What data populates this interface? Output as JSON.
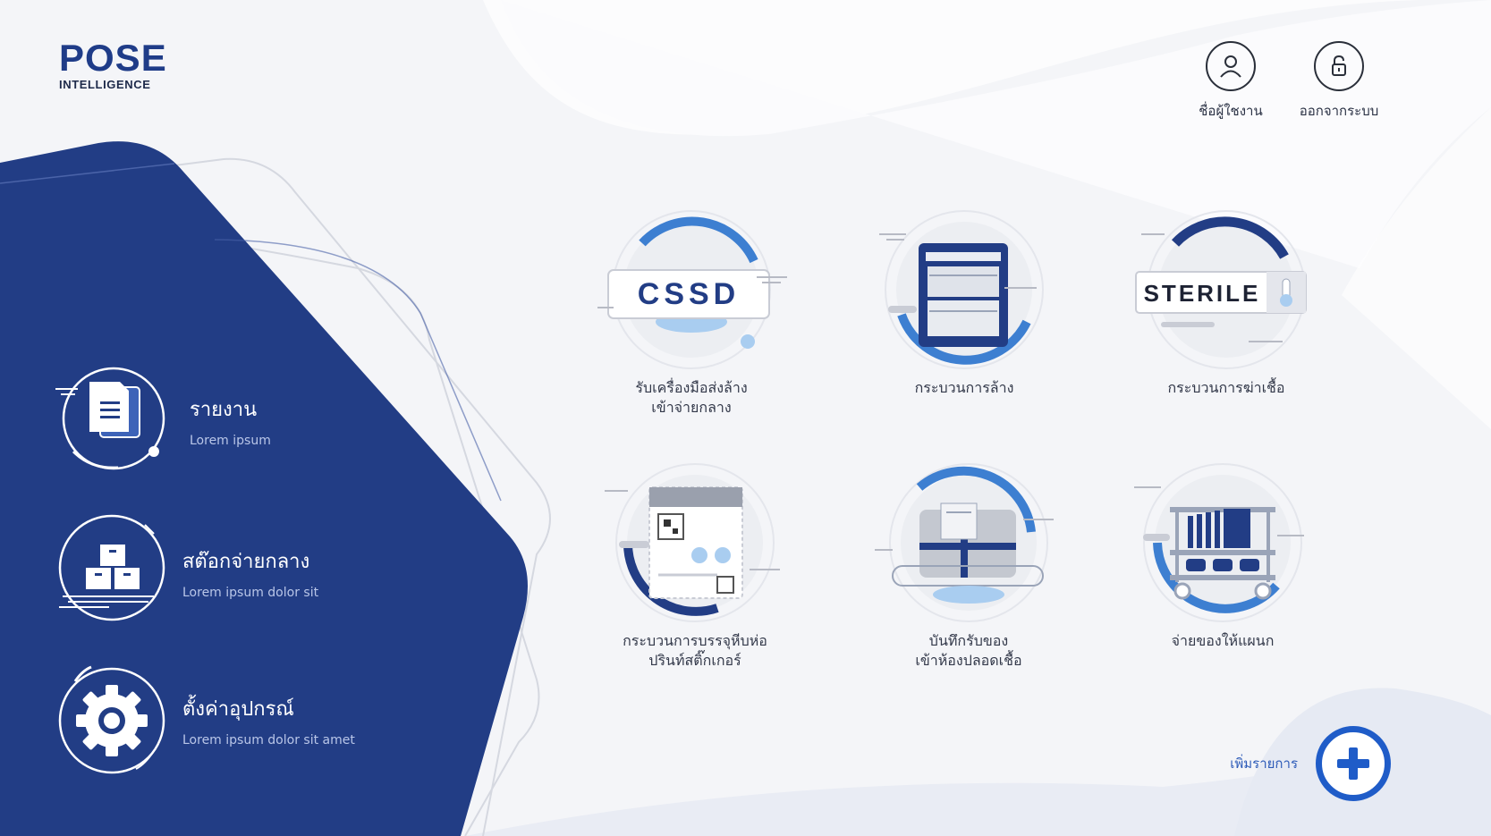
{
  "brand": {
    "name": "POSE",
    "tagline": "INTELLIGENCE"
  },
  "header": {
    "user_label": "ชื่อผู้ใชงาน",
    "logout_label": "ออกจากระบบ"
  },
  "sidebar": {
    "items": [
      {
        "title": "รายงาน",
        "subtitle": "Lorem ipsum",
        "icon": "report-icon"
      },
      {
        "title": "สต๊อกจ่ายกลาง",
        "subtitle": "Lorem ipsum dolor sit",
        "icon": "boxes-icon"
      },
      {
        "title": "ตั้งค่าอุปกรณ์",
        "subtitle": "Lorem ipsum dolor sit amet",
        "icon": "gear-icon"
      }
    ]
  },
  "tiles": [
    {
      "line1": "รับเครื่องมือส่งล้าง",
      "line2": "เข้าจ่ายกลาง",
      "badge": "CSSD",
      "icon": "cssd-icon"
    },
    {
      "line1": "กระบวนการล้าง",
      "line2": "",
      "icon": "washer-icon"
    },
    {
      "line1": "กระบวนการฆ่าเชื้อ",
      "line2": "",
      "badge": "STERILE",
      "icon": "sterile-icon"
    },
    {
      "line1": "กระบวนการบรรจุหีบห่อ",
      "line2": "ปรินท์สติ๊กเกอร์",
      "icon": "sticker-icon"
    },
    {
      "line1": "บันทึกรับของ",
      "line2": "เข้าห้องปลอดเชื้อ",
      "icon": "package-icon"
    },
    {
      "line1": "จ่ายของให้แผนก",
      "line2": "",
      "icon": "cart-icon"
    }
  ],
  "add": {
    "label": "เพิ่มรายการ"
  },
  "colors": {
    "brand_blue": "#223d85",
    "accent_blue": "#3d7fd1",
    "light_blue": "#a9cdf0",
    "background": "#f4f5f8"
  }
}
